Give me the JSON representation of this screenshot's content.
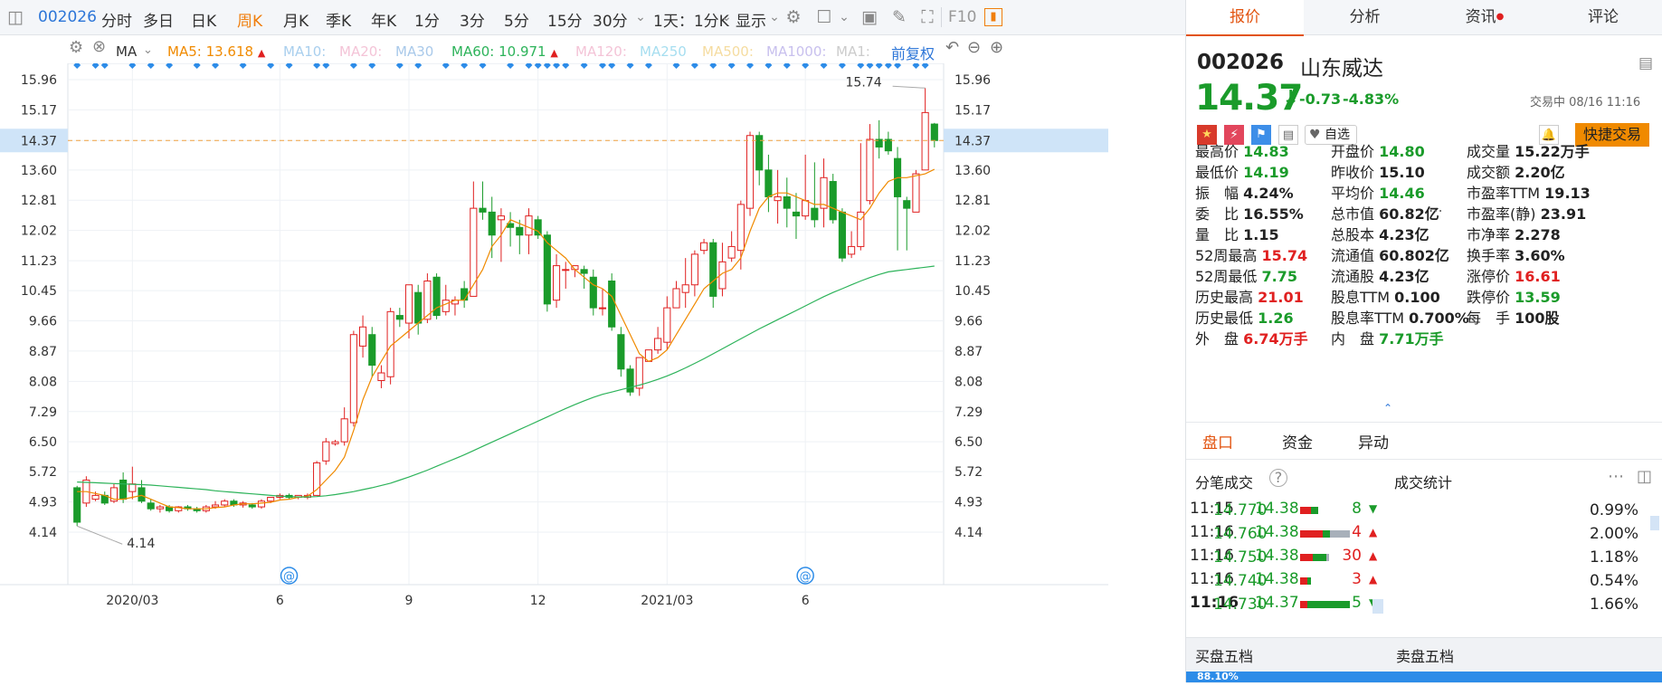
{
  "toolbar": {
    "code": "002026",
    "periods": [
      "分时",
      "多日",
      "日K",
      "周K",
      "月K",
      "季K",
      "年K",
      "1分",
      "3分",
      "5分",
      "15分",
      "30分"
    ],
    "active_period": "周K",
    "range": "1天：1分K",
    "display": "显示",
    "f10": "F10"
  },
  "ma_row": {
    "name": "MA",
    "ma5": "MA5: 13.618",
    "ma10": "MA10:",
    "ma20": "MA20:",
    "ma30": "MA30",
    "ma60": "MA60: 10.971",
    "ma120": "MA120:",
    "ma250": "MA250",
    "ma500": "MA500:",
    "ma1000": "MA1000:",
    "ma1x": "MA1:",
    "fq": "前复权"
  },
  "chart_data": {
    "type": "candlestick",
    "ylim": [
      4.14,
      15.96
    ],
    "y_ticks": [
      "15.96",
      "15.17",
      "14.37",
      "13.60",
      "12.81",
      "12.02",
      "11.23",
      "10.45",
      "9.66",
      "8.87",
      "8.08",
      "7.29",
      "6.50",
      "5.72",
      "4.93",
      "4.14"
    ],
    "current_price": "14.37",
    "x_labels": [
      "2020/03",
      "6",
      "9",
      "12",
      "2021/03",
      "6"
    ],
    "x_label_at": [
      6,
      22,
      36,
      50,
      64,
      79
    ],
    "high_label": "15.74",
    "low_label": "4.14",
    "candles": [
      [
        5.3,
        4.4,
        5.35,
        4.3
      ],
      [
        4.9,
        5.5,
        5.6,
        4.8
      ],
      [
        5.0,
        5.1,
        5.2,
        4.95
      ],
      [
        5.1,
        4.9,
        5.2,
        4.85
      ],
      [
        4.95,
        5.3,
        5.4,
        4.9
      ],
      [
        5.5,
        5.0,
        5.7,
        4.9
      ],
      [
        5.2,
        5.4,
        5.85,
        5.0
      ],
      [
        5.3,
        4.95,
        5.5,
        4.9
      ],
      [
        4.9,
        4.75,
        5.0,
        4.7
      ],
      [
        4.75,
        4.8,
        4.85,
        4.65
      ],
      [
        4.8,
        4.7,
        4.85,
        4.65
      ],
      [
        4.7,
        4.8,
        4.82,
        4.65
      ],
      [
        4.8,
        4.75,
        4.85,
        4.7
      ],
      [
        4.75,
        4.7,
        4.8,
        4.65
      ],
      [
        4.7,
        4.8,
        4.85,
        4.65
      ],
      [
        4.8,
        4.85,
        4.95,
        4.75
      ],
      [
        4.85,
        4.95,
        5.0,
        4.8
      ],
      [
        4.95,
        4.85,
        5.0,
        4.8
      ],
      [
        4.85,
        4.9,
        4.95,
        4.78
      ],
      [
        4.85,
        4.8,
        4.9,
        4.75
      ],
      [
        4.8,
        4.95,
        5.0,
        4.75
      ],
      [
        4.95,
        5.05,
        5.05,
        4.9
      ],
      [
        5.05,
        5.1,
        5.15,
        5.0
      ],
      [
        5.1,
        5.05,
        5.15,
        5.0
      ],
      [
        5.05,
        5.1,
        5.1,
        5.0
      ],
      [
        5.05,
        5.1,
        5.15,
        5.0
      ],
      [
        5.1,
        5.95,
        6.0,
        5.1
      ],
      [
        6.0,
        6.5,
        6.6,
        5.9
      ],
      [
        6.45,
        6.5,
        6.55,
        6.4
      ],
      [
        6.5,
        7.1,
        7.4,
        6.4
      ],
      [
        7.0,
        9.3,
        9.4,
        6.9
      ],
      [
        9.0,
        9.5,
        9.8,
        8.7
      ],
      [
        9.3,
        8.5,
        9.5,
        8.2
      ],
      [
        8.1,
        8.3,
        8.5,
        7.9
      ],
      [
        8.2,
        9.9,
        10.0,
        8.0
      ],
      [
        9.8,
        9.7,
        10.0,
        9.5
      ],
      [
        9.6,
        10.6,
        10.6,
        9.2
      ],
      [
        10.4,
        9.6,
        10.6,
        9.3
      ],
      [
        9.7,
        10.7,
        10.9,
        9.6
      ],
      [
        10.8,
        9.8,
        10.9,
        9.7
      ],
      [
        9.9,
        10.2,
        10.6,
        9.8
      ],
      [
        10.1,
        10.2,
        10.3,
        9.8
      ],
      [
        10.5,
        10.2,
        10.7,
        10.0
      ],
      [
        10.3,
        12.6,
        13.3,
        10.3
      ],
      [
        12.6,
        12.5,
        13.3,
        12.3
      ],
      [
        12.5,
        11.9,
        12.9,
        11.3
      ],
      [
        12.3,
        12.4,
        12.6,
        11.2
      ],
      [
        12.2,
        12.1,
        12.5,
        11.6
      ],
      [
        12.1,
        11.9,
        12.3,
        11.4
      ],
      [
        11.9,
        12.4,
        12.6,
        11.4
      ],
      [
        12.3,
        11.9,
        12.4,
        11.8
      ],
      [
        11.9,
        10.1,
        12.0,
        9.9
      ],
      [
        10.2,
        11.1,
        11.4,
        10.0
      ],
      [
        11.0,
        11.0,
        11.2,
        10.5
      ],
      [
        11.0,
        11.1,
        11.1,
        10.8
      ],
      [
        11.0,
        10.9,
        11.1,
        10.5
      ],
      [
        10.8,
        10.0,
        11.0,
        9.8
      ],
      [
        10.0,
        10.0,
        10.5,
        9.8
      ],
      [
        10.7,
        9.5,
        10.9,
        9.4
      ],
      [
        9.3,
        8.4,
        9.5,
        8.2
      ],
      [
        8.4,
        7.8,
        8.5,
        7.7
      ],
      [
        7.9,
        8.7,
        8.7,
        7.7
      ],
      [
        8.6,
        8.9,
        8.9,
        8.6
      ],
      [
        8.9,
        9.2,
        9.5,
        8.8
      ],
      [
        9.1,
        10.0,
        10.3,
        8.9
      ],
      [
        10.0,
        10.5,
        10.7,
        10.2
      ],
      [
        10.4,
        10.6,
        11.3,
        10.0
      ],
      [
        10.6,
        11.4,
        11.5,
        10.3
      ],
      [
        11.5,
        11.7,
        11.8,
        11.4
      ],
      [
        11.7,
        10.3,
        11.8,
        10.0
      ],
      [
        10.5,
        11.2,
        11.7,
        10.3
      ],
      [
        11.3,
        11.6,
        12.0,
        11.2
      ],
      [
        11.5,
        12.7,
        12.8,
        11.0
      ],
      [
        12.6,
        14.5,
        14.6,
        12.4
      ],
      [
        14.5,
        13.6,
        14.6,
        13.2
      ],
      [
        13.6,
        12.9,
        14.0,
        12.5
      ],
      [
        12.8,
        12.9,
        13.6,
        12.2
      ],
      [
        12.9,
        12.6,
        13.4,
        12.1
      ],
      [
        12.5,
        12.4,
        13.0,
        11.8
      ],
      [
        12.4,
        12.8,
        14.0,
        12.3
      ],
      [
        12.6,
        12.3,
        13.8,
        12.1
      ],
      [
        12.6,
        13.4,
        13.9,
        12.1
      ],
      [
        13.3,
        12.3,
        13.5,
        12.2
      ],
      [
        12.5,
        11.3,
        12.6,
        11.2
      ],
      [
        11.4,
        11.6,
        12.0,
        11.3
      ],
      [
        11.6,
        12.5,
        14.3,
        11.5
      ],
      [
        12.8,
        14.4,
        14.8,
        12.7
      ],
      [
        14.4,
        14.2,
        14.9,
        13.9
      ],
      [
        14.4,
        14.1,
        14.6,
        14.0
      ],
      [
        13.9,
        12.9,
        14.2,
        11.5
      ],
      [
        12.8,
        12.6,
        12.9,
        11.5
      ],
      [
        12.5,
        13.5,
        13.6,
        12.5
      ],
      [
        13.6,
        15.1,
        15.74,
        13.6
      ],
      [
        14.8,
        14.37,
        14.83,
        14.19
      ]
    ],
    "ma5": [
      5.2,
      5.2,
      5.15,
      5.1,
      5.0,
      5.0,
      5.05,
      5.1,
      5.0,
      4.9,
      4.8,
      4.78,
      4.75,
      4.75,
      4.75,
      4.78,
      4.8,
      4.85,
      4.88,
      4.88,
      4.9,
      4.92,
      4.98,
      5.0,
      5.05,
      5.08,
      5.25,
      5.5,
      5.75,
      6.1,
      6.8,
      7.6,
      8.2,
      8.6,
      9.0,
      9.2,
      9.4,
      9.6,
      9.8,
      10.0,
      10.1,
      10.2,
      10.2,
      10.6,
      11.0,
      11.6,
      11.9,
      12.3,
      12.2,
      12.1,
      12.0,
      11.7,
      11.5,
      11.3,
      11.0,
      10.8,
      10.6,
      10.5,
      10.3,
      9.8,
      9.3,
      8.8,
      8.6,
      8.7,
      8.9,
      9.3,
      9.7,
      10.1,
      10.5,
      10.7,
      10.9,
      11.0,
      11.3,
      12.0,
      12.6,
      12.9,
      13.0,
      13.0,
      12.9,
      12.8,
      12.7,
      12.7,
      12.6,
      12.5,
      12.4,
      12.3,
      12.6,
      13.0,
      13.3,
      13.4,
      13.4,
      13.45,
      13.5,
      13.618
    ],
    "ma60": [
      5.45,
      5.44,
      5.43,
      5.42,
      5.41,
      5.4,
      5.39,
      5.38,
      5.37,
      5.35,
      5.33,
      5.31,
      5.29,
      5.27,
      5.25,
      5.22,
      5.2,
      5.18,
      5.16,
      5.14,
      5.12,
      5.1,
      5.08,
      5.07,
      5.06,
      5.06,
      5.07,
      5.09,
      5.12,
      5.16,
      5.2,
      5.25,
      5.3,
      5.36,
      5.42,
      5.5,
      5.58,
      5.67,
      5.76,
      5.86,
      5.96,
      6.06,
      6.16,
      6.27,
      6.38,
      6.49,
      6.6,
      6.71,
      6.82,
      6.93,
      7.04,
      7.15,
      7.26,
      7.37,
      7.47,
      7.57,
      7.66,
      7.74,
      7.8,
      7.86,
      7.92,
      7.98,
      8.05,
      8.13,
      8.22,
      8.32,
      8.43,
      8.55,
      8.67,
      8.8,
      8.93,
      9.06,
      9.19,
      9.32,
      9.45,
      9.57,
      9.69,
      9.81,
      9.93,
      10.05,
      10.17,
      10.29,
      10.4,
      10.5,
      10.6,
      10.7,
      10.79,
      10.87,
      10.94,
      10.971,
      11.0,
      11.03,
      11.06,
      11.09
    ]
  },
  "quote": {
    "tabs": [
      "报价",
      "分析",
      "资讯",
      "评论"
    ],
    "active_tab": "报价",
    "code": "002026",
    "name": "山东威达",
    "price": "14.37",
    "change": "-0.73",
    "pct": "-4.83%",
    "trade_status": "交易中 08/16 11:16",
    "self_select": "自选",
    "quick_trade": "快捷交易"
  },
  "stats": [
    [
      {
        "k": "最高价",
        "v": "14.83",
        "c": "green"
      },
      {
        "k": "开盘价",
        "v": "14.80",
        "c": "green"
      },
      {
        "k": "成交量",
        "v": "15.22万手",
        "c": ""
      }
    ],
    [
      {
        "k": "最低价",
        "v": "14.19",
        "c": "green"
      },
      {
        "k": "昨收价",
        "v": "15.10",
        "c": ""
      },
      {
        "k": "成交额",
        "v": "2.20亿",
        "c": ""
      }
    ],
    [
      {
        "k": "振　幅",
        "v": "4.24%",
        "c": ""
      },
      {
        "k": "平均价",
        "v": "14.46",
        "c": "green"
      },
      {
        "k": "市盈率TTM",
        "v": "19.13",
        "c": ""
      }
    ],
    [
      {
        "k": "委　比",
        "v": "16.55%",
        "c": ""
      },
      {
        "k": "总市值",
        "v": "60.82亿",
        "c": ""
      },
      {
        "k": "市盈率(静)",
        "v": "23.91",
        "c": ""
      }
    ],
    [
      {
        "k": "量　比",
        "v": "1.15",
        "c": ""
      },
      {
        "k": "总股本",
        "v": "4.23亿",
        "c": ""
      },
      {
        "k": "市净率",
        "v": "2.278",
        "c": ""
      }
    ],
    [
      {
        "k": "52周最高",
        "v": "15.74",
        "c": "red"
      },
      {
        "k": "流通值",
        "v": "60.802亿",
        "c": ""
      },
      {
        "k": "换手率",
        "v": "3.60%",
        "c": ""
      }
    ],
    [
      {
        "k": "52周最低",
        "v": "7.75",
        "c": "green"
      },
      {
        "k": "流通股",
        "v": "4.23亿",
        "c": ""
      },
      {
        "k": "涨停价",
        "v": "16.61",
        "c": "red"
      }
    ],
    [
      {
        "k": "历史最高",
        "v": "21.01",
        "c": "red"
      },
      {
        "k": "股息TTM",
        "v": "0.100",
        "c": ""
      },
      {
        "k": "跌停价",
        "v": "13.59",
        "c": "green"
      }
    ],
    [
      {
        "k": "历史最低",
        "v": "1.26",
        "c": "green"
      },
      {
        "k": "股息率TTM",
        "v": "0.700%",
        "c": ""
      },
      {
        "k": "每　手",
        "v": "100股",
        "c": ""
      }
    ],
    [
      {
        "k": "外　盘",
        "v": "6.74万手",
        "c": "red"
      },
      {
        "k": "内　盘",
        "v": "7.71万手",
        "c": "green"
      },
      {
        "k": "",
        "v": "",
        "c": ""
      }
    ]
  ],
  "subtabs": [
    "盘口",
    "资金",
    "异动"
  ],
  "active_subtab": "盘口",
  "ticks_title": "分笔成交",
  "volstat_title": "成交统计",
  "ticks": [
    {
      "t": "11:15",
      "p": "14.38",
      "v": "8",
      "dir": "down"
    },
    {
      "t": "11:16",
      "p": "14.38",
      "v": "4",
      "dir": "up"
    },
    {
      "t": "11:16",
      "p": "14.38",
      "v": "30",
      "dir": "up"
    },
    {
      "t": "11:16",
      "p": "14.38",
      "v": "3",
      "dir": "up"
    },
    {
      "t": "11:16",
      "p": "14.37",
      "v": "5",
      "dir": "down"
    }
  ],
  "volstats": [
    {
      "p": "14.770",
      "pct": "0.99%",
      "r": 0.6,
      "g": 0.4,
      "gray": 0,
      "frac": 0.2
    },
    {
      "p": "14.760",
      "pct": "2.00%",
      "r": 0.45,
      "g": 0.15,
      "gray": 0.4,
      "frac": 0.55
    },
    {
      "p": "14.750",
      "pct": "1.18%",
      "r": 0.45,
      "g": 0.45,
      "gray": 0.1,
      "frac": 0.32
    },
    {
      "p": "14.740",
      "pct": "0.54%",
      "r": 0.7,
      "g": 0.3,
      "gray": 0,
      "frac": 0.12
    },
    {
      "p": "14.730",
      "pct": "1.66%",
      "r": 0.15,
      "g": 0.85,
      "gray": 0,
      "frac": 0.55
    }
  ],
  "bid_title": "买盘五档",
  "ask_title": "卖盘五档",
  "bottom_bar": "88.10%",
  "colors": {
    "up": "#e02020",
    "down": "#1a9b2a",
    "ma5": "#f08a00",
    "ma60": "#2db35a",
    "accent": "#e2530f",
    "blue": "#2d76d8"
  }
}
